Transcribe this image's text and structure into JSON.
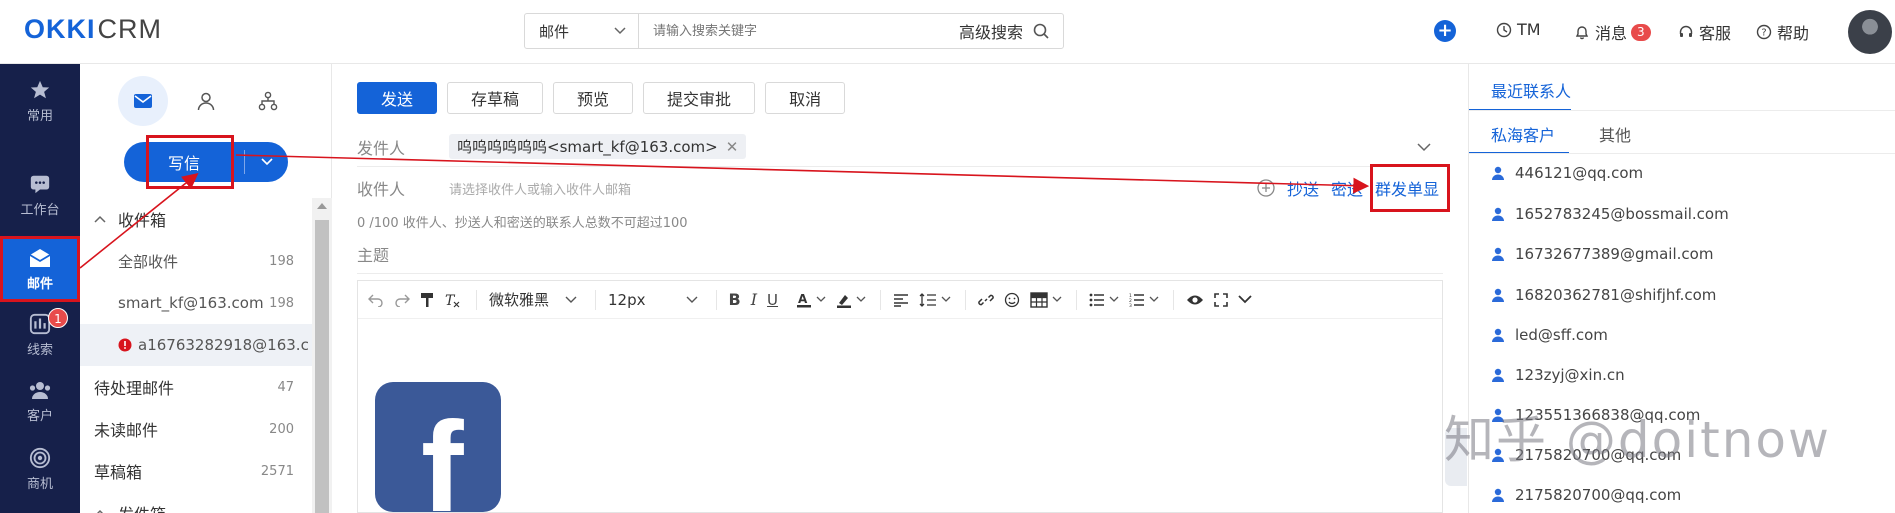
{
  "logo": {
    "brand": "OKKI",
    "product": "CRM"
  },
  "search": {
    "category": "邮件",
    "placeholder": "请输入搜索关键字",
    "advanced": "高级搜索"
  },
  "topnav": {
    "tm": "TM",
    "messages": "消息",
    "messages_count": "3",
    "service": "客服",
    "help": "帮助"
  },
  "leftnav": [
    {
      "label": "常用",
      "icon": "star-icon"
    },
    {
      "label": "工作台",
      "icon": "chat-icon"
    },
    {
      "label": "邮件",
      "icon": "mail-icon"
    },
    {
      "label": "线索",
      "icon": "clue-icon",
      "badge": "1"
    },
    {
      "label": "客户",
      "icon": "people-icon"
    },
    {
      "label": "商机",
      "icon": "target-icon"
    }
  ],
  "compose": {
    "label": "写信"
  },
  "folders": [
    {
      "label": "收件箱",
      "count": ""
    },
    {
      "label": "全部收件",
      "count": "198"
    },
    {
      "label": "smart_kf@163.com",
      "count": "198"
    },
    {
      "label": "a16763282918@163.c",
      "count": ""
    },
    {
      "label": "待处理邮件",
      "count": "47"
    },
    {
      "label": "未读邮件",
      "count": "200"
    },
    {
      "label": "草稿箱",
      "count": "2571"
    },
    {
      "label": "发件箱",
      "count": ""
    }
  ],
  "toolbar": {
    "send": "发送",
    "save_draft": "存草稿",
    "preview": "预览",
    "submit_review": "提交审批",
    "cancel": "取消"
  },
  "form": {
    "sender_label": "发件人",
    "sender_value": "呜呜呜呜呜呜<smart_kf@163.com>",
    "recipient_label": "收件人",
    "recipient_placeholder": "请选择收件人或输入收件人邮箱",
    "cc": "抄送",
    "bcc": "密送",
    "group_send": "群发单显",
    "hint": "0 /100 收件人、抄送人和密送的联系人总数不可超过100",
    "subject_label": "主题"
  },
  "editor": {
    "font": "微软雅黑",
    "size": "12px"
  },
  "right": {
    "title": "最近联系人",
    "tab_private": "私海客户",
    "tab_other": "其他",
    "contacts": [
      "446121@qq.com",
      "1652783245@bossmail.com",
      "16732677389@gmail.com",
      "16820362781@shifjhf.com",
      "led@sff.com",
      "123zyj@xin.cn",
      "123551366838@qq.com",
      "2175820700@qq.com",
      "2175820700@qq.com"
    ]
  },
  "watermark": "知乎 @doitnow",
  "colors": {
    "accent": "#1463d8",
    "nav_bg": "#16204a",
    "highlight": "#d8141d"
  }
}
